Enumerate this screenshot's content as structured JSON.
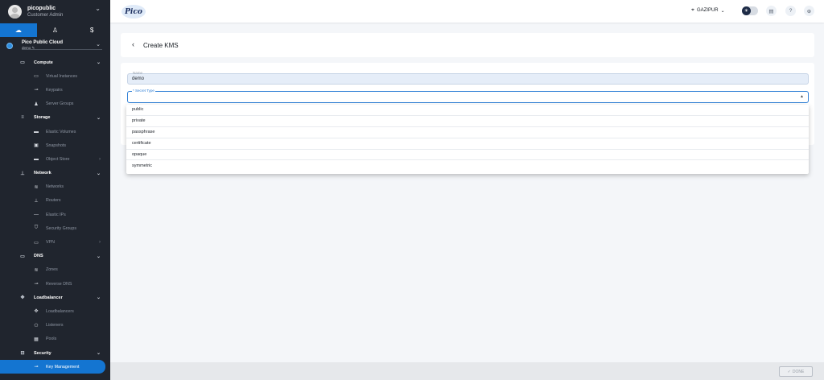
{
  "user": {
    "name": "picopublic",
    "role": "Customer Admin"
  },
  "tabs": [
    {
      "icon": "cloud-icon",
      "glyph": "☁"
    },
    {
      "icon": "user-icon",
      "glyph": "♙"
    },
    {
      "icon": "billing-icon",
      "glyph": "$"
    }
  ],
  "project": {
    "name": "Pico Public Cloud",
    "sub": "demo ✎"
  },
  "nav": [
    {
      "type": "section",
      "key": "compute",
      "label": "Compute",
      "glyph": "▭",
      "chev": "⌄"
    },
    {
      "type": "sub",
      "key": "virtual-instances",
      "label": "Virtual Instances",
      "glyph": "▭"
    },
    {
      "type": "sub",
      "key": "keypairs",
      "label": "Keypairs",
      "glyph": "⊸"
    },
    {
      "type": "sub",
      "key": "server-groups",
      "label": "Server Groups",
      "glyph": "♟"
    },
    {
      "type": "section",
      "key": "storage",
      "label": "Storage",
      "glyph": "≡",
      "chev": "⌄"
    },
    {
      "type": "sub",
      "key": "elastic-volumes",
      "label": "Elastic Volumes",
      "glyph": "▬"
    },
    {
      "type": "sub",
      "key": "snapshots",
      "label": "Snapshots",
      "glyph": "▣"
    },
    {
      "type": "sub",
      "key": "object-store",
      "label": "Object Store",
      "glyph": "▬",
      "chev": "›"
    },
    {
      "type": "section",
      "key": "network",
      "label": "Network",
      "glyph": "⊥",
      "chev": "⌄"
    },
    {
      "type": "sub",
      "key": "networks",
      "label": "Networks",
      "glyph": "≋"
    },
    {
      "type": "sub",
      "key": "routers",
      "label": "Routers",
      "glyph": "⊥"
    },
    {
      "type": "sub",
      "key": "elastic-ips",
      "label": "Elastic IPs",
      "glyph": "—"
    },
    {
      "type": "sub",
      "key": "security-groups",
      "label": "Security Groups",
      "glyph": "⛉"
    },
    {
      "type": "sub",
      "key": "vpn",
      "label": "VPN",
      "glyph": "▭",
      "chev": "›"
    },
    {
      "type": "section",
      "key": "dns",
      "label": "DNS",
      "glyph": "▭",
      "chev": "⌄"
    },
    {
      "type": "sub",
      "key": "zones",
      "label": "Zones",
      "glyph": "≋"
    },
    {
      "type": "sub",
      "key": "reverse-dns",
      "label": "Reverse DNS",
      "glyph": "⊸"
    },
    {
      "type": "section",
      "key": "loadbalancer",
      "label": "Loadbalancer",
      "glyph": "✥",
      "chev": "⌄"
    },
    {
      "type": "sub",
      "key": "loadbalancers",
      "label": "Loadbalancers",
      "glyph": "✥"
    },
    {
      "type": "sub",
      "key": "listeners",
      "label": "Listeners",
      "glyph": "⚇"
    },
    {
      "type": "sub",
      "key": "pools",
      "label": "Pools",
      "glyph": "▦"
    },
    {
      "type": "section",
      "key": "security",
      "label": "Security",
      "glyph": "⊟",
      "chev": "⌄"
    },
    {
      "type": "sub",
      "key": "key-management",
      "label": "Key Management",
      "glyph": "⊸",
      "active": true
    }
  ],
  "topbar": {
    "logo": "Pico",
    "location": "GAZIPUR",
    "location_chev": "⌄",
    "theme_glyph": "☀",
    "icons": [
      {
        "name": "docs-icon",
        "glyph": "▤"
      },
      {
        "name": "help-icon",
        "glyph": "?"
      },
      {
        "name": "language-icon",
        "glyph": "⊕"
      }
    ]
  },
  "page": {
    "back_glyph": "‹",
    "title": "Create KMS"
  },
  "form": {
    "name_label": "Name",
    "name_value": "demo",
    "secret_label": "* Secret Type",
    "secret_value": "",
    "caret": "▲"
  },
  "dropdown": {
    "options": [
      "public",
      "private",
      "passphrase",
      "certificate",
      "opaque",
      "symmetric"
    ]
  },
  "footer": {
    "done_label": "DONE",
    "done_glyph": "✓"
  },
  "colors": {
    "accent": "#1475d1",
    "sidebar": "#20252e"
  }
}
